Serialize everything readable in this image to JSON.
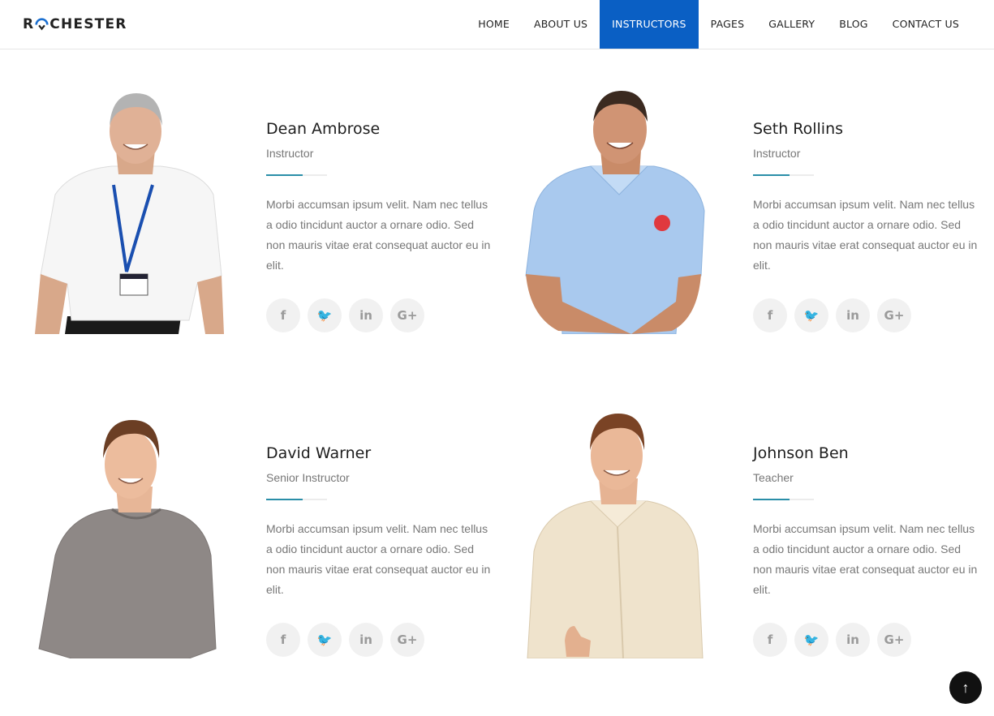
{
  "brand": {
    "logo_left": "R",
    "logo_right": "CHESTER"
  },
  "nav": {
    "items": [
      {
        "label": "HOME"
      },
      {
        "label": "ABOUT US"
      },
      {
        "label": "INSTRUCTORS",
        "active": true
      },
      {
        "label": "PAGES"
      },
      {
        "label": "GALLERY"
      },
      {
        "label": "BLOG"
      },
      {
        "label": "CONTACT US"
      }
    ]
  },
  "colors": {
    "accent": "#0a5fc4",
    "divider_accent": "#2a8ea8",
    "social_bg": "#f1f1f1"
  },
  "instructors": [
    {
      "name": "Dean Ambrose",
      "role": "Instructor",
      "description": "Morbi accumsan ipsum velit. Nam nec tellus a odio tincidunt auctor a ornare odio. Sed non mauris vitae erat consequat auctor eu in elit.",
      "socials": [
        "f",
        "🐦",
        "in",
        "G+"
      ]
    },
    {
      "name": "Seth Rollins",
      "role": "Instructor",
      "description": "Morbi accumsan ipsum velit. Nam nec tellus a odio tincidunt auctor a ornare odio. Sed non mauris vitae erat consequat auctor eu in elit.",
      "socials": [
        "f",
        "🐦",
        "in",
        "G+"
      ]
    },
    {
      "name": "David Warner",
      "role": "Senior Instructor",
      "description": "Morbi accumsan ipsum velit. Nam nec tellus a odio tincidunt auctor a ornare odio. Sed non mauris vitae erat consequat auctor eu in elit.",
      "socials": [
        "f",
        "🐦",
        "in",
        "G+"
      ]
    },
    {
      "name": "Johnson Ben",
      "role": "Teacher",
      "description": "Morbi accumsan ipsum velit. Nam nec tellus a odio tincidunt auctor a ornare odio. Sed non mauris vitae erat consequat auctor eu in elit.",
      "socials": [
        "f",
        "🐦",
        "in",
        "G+"
      ]
    }
  ],
  "icons": {
    "social": [
      "facebook-icon",
      "twitter-icon",
      "linkedin-icon",
      "google-plus-icon"
    ],
    "scroll_top": "arrow-up-icon"
  },
  "scroll_top_glyph": "↑"
}
